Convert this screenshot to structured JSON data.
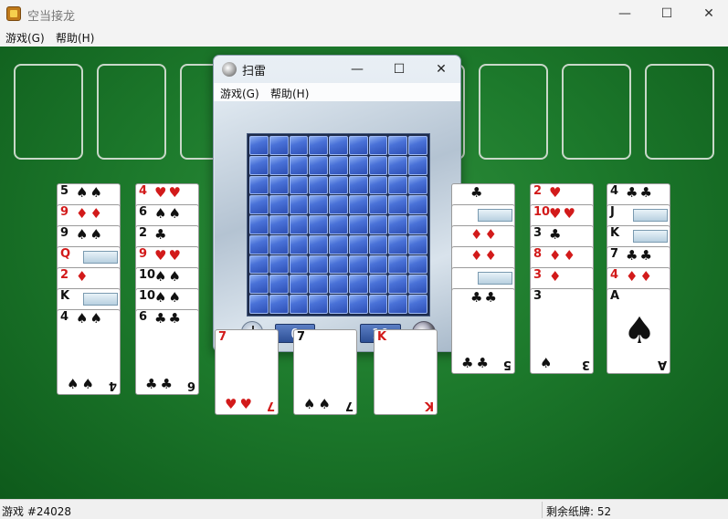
{
  "window": {
    "title": "空当接龙",
    "minimize_glyph": "—",
    "maximize_glyph": "☐",
    "close_glyph": "✕"
  },
  "menu": {
    "game": "游戏(G)",
    "help": "帮助(H)"
  },
  "minesweeper": {
    "title": "扫雷",
    "menu": {
      "game": "游戏(G)",
      "help": "帮助(H)"
    },
    "time": "0",
    "mines_remaining": "10",
    "grid_rows": 9,
    "grid_cols": 9
  },
  "columns": [
    {
      "cards": [
        {
          "rank": "5",
          "suit": "♠",
          "color": "black",
          "pips": "♠♠"
        },
        {
          "rank": "9",
          "suit": "♦",
          "color": "red",
          "pips": "♦♦"
        },
        {
          "rank": "9",
          "suit": "♠",
          "color": "black",
          "pips": "♠♠"
        },
        {
          "rank": "Q",
          "suit": "♦",
          "color": "red",
          "face": true
        },
        {
          "rank": "2",
          "suit": "♦",
          "color": "red",
          "pips": "♦"
        },
        {
          "rank": "K",
          "suit": "♦",
          "color": "black",
          "face": true
        },
        {
          "rank": "4",
          "suit": "♠",
          "color": "black",
          "pips": "♠♠",
          "bottom": "♠♠",
          "brank": "4"
        }
      ]
    },
    {
      "cards": [
        {
          "rank": "4",
          "suit": "♥",
          "color": "red",
          "pips": "♥♥"
        },
        {
          "rank": "6",
          "suit": "♠",
          "color": "black",
          "pips": "♠♠"
        },
        {
          "rank": "2",
          "suit": "♣",
          "color": "black",
          "pips": "♣"
        },
        {
          "rank": "9",
          "suit": "♥",
          "color": "red",
          "pips": "♥♥"
        },
        {
          "rank": "10",
          "suit": "♠",
          "color": "black",
          "pips": "♠♠"
        },
        {
          "rank": "10",
          "suit": "♠",
          "color": "black",
          "pips": "♠♠"
        },
        {
          "rank": "6",
          "suit": "♣",
          "color": "black",
          "pips": "♣♣",
          "bottom": "♣♣",
          "brank": "6"
        }
      ]
    },
    {
      "cards": [
        {
          "rank": "7",
          "suit": "♥",
          "color": "red",
          "pips": "",
          "bottom": "♥♥",
          "brank": "7"
        }
      ]
    },
    {
      "cards": [
        {
          "rank": "7",
          "suit": "♠",
          "color": "black",
          "pips": "",
          "bottom": "♠♠",
          "brank": "7"
        }
      ]
    },
    {
      "cards": [
        {
          "rank": "K",
          "suit": "♦",
          "color": "red",
          "pips": "",
          "bottom": "",
          "brank": "K"
        }
      ]
    },
    {
      "cards": [
        {
          "rank": "",
          "suit": "♣",
          "color": "black",
          "pips": "♣"
        },
        {
          "rank": "",
          "suit": "♦",
          "color": "red",
          "face": true
        },
        {
          "rank": "",
          "suit": "♦",
          "color": "red",
          "pips": "♦♦"
        },
        {
          "rank": "",
          "suit": "♦",
          "color": "red",
          "pips": "♦♦"
        },
        {
          "rank": "",
          "suit": "♦",
          "color": "red",
          "face": true
        },
        {
          "rank": "",
          "suit": "♣",
          "color": "black",
          "pips": "♣♣",
          "bottom": "♣♣",
          "brank": "5"
        }
      ]
    },
    {
      "cards": [
        {
          "rank": "2",
          "suit": "♥",
          "color": "red",
          "pips": "♥"
        },
        {
          "rank": "10",
          "suit": "♥",
          "color": "red",
          "pips": "♥♥"
        },
        {
          "rank": "3",
          "suit": "♣",
          "color": "black",
          "pips": "♣"
        },
        {
          "rank": "8",
          "suit": "♦",
          "color": "red",
          "pips": "♦♦"
        },
        {
          "rank": "3",
          "suit": "♦",
          "color": "red",
          "pips": "♦"
        },
        {
          "rank": "3",
          "suit": "♠",
          "color": "black",
          "pips": "",
          "bottom": "♠",
          "brank": "3"
        }
      ]
    },
    {
      "cards": [
        {
          "rank": "4",
          "suit": "♣",
          "color": "black",
          "pips": "♣♣"
        },
        {
          "rank": "J",
          "suit": "♠",
          "color": "black",
          "face": true
        },
        {
          "rank": "K",
          "suit": "♠",
          "color": "black",
          "face": true
        },
        {
          "rank": "7",
          "suit": "♣",
          "color": "black",
          "pips": "♣♣"
        },
        {
          "rank": "4",
          "suit": "♦",
          "color": "red",
          "pips": "♦♦"
        },
        {
          "rank": "A",
          "suit": "♠",
          "color": "black",
          "pips": "",
          "big": "♠",
          "bottom": "",
          "brank": "A"
        }
      ]
    }
  ],
  "status": {
    "game": "游戏 #24028",
    "remaining": "剩余纸牌: 52"
  }
}
